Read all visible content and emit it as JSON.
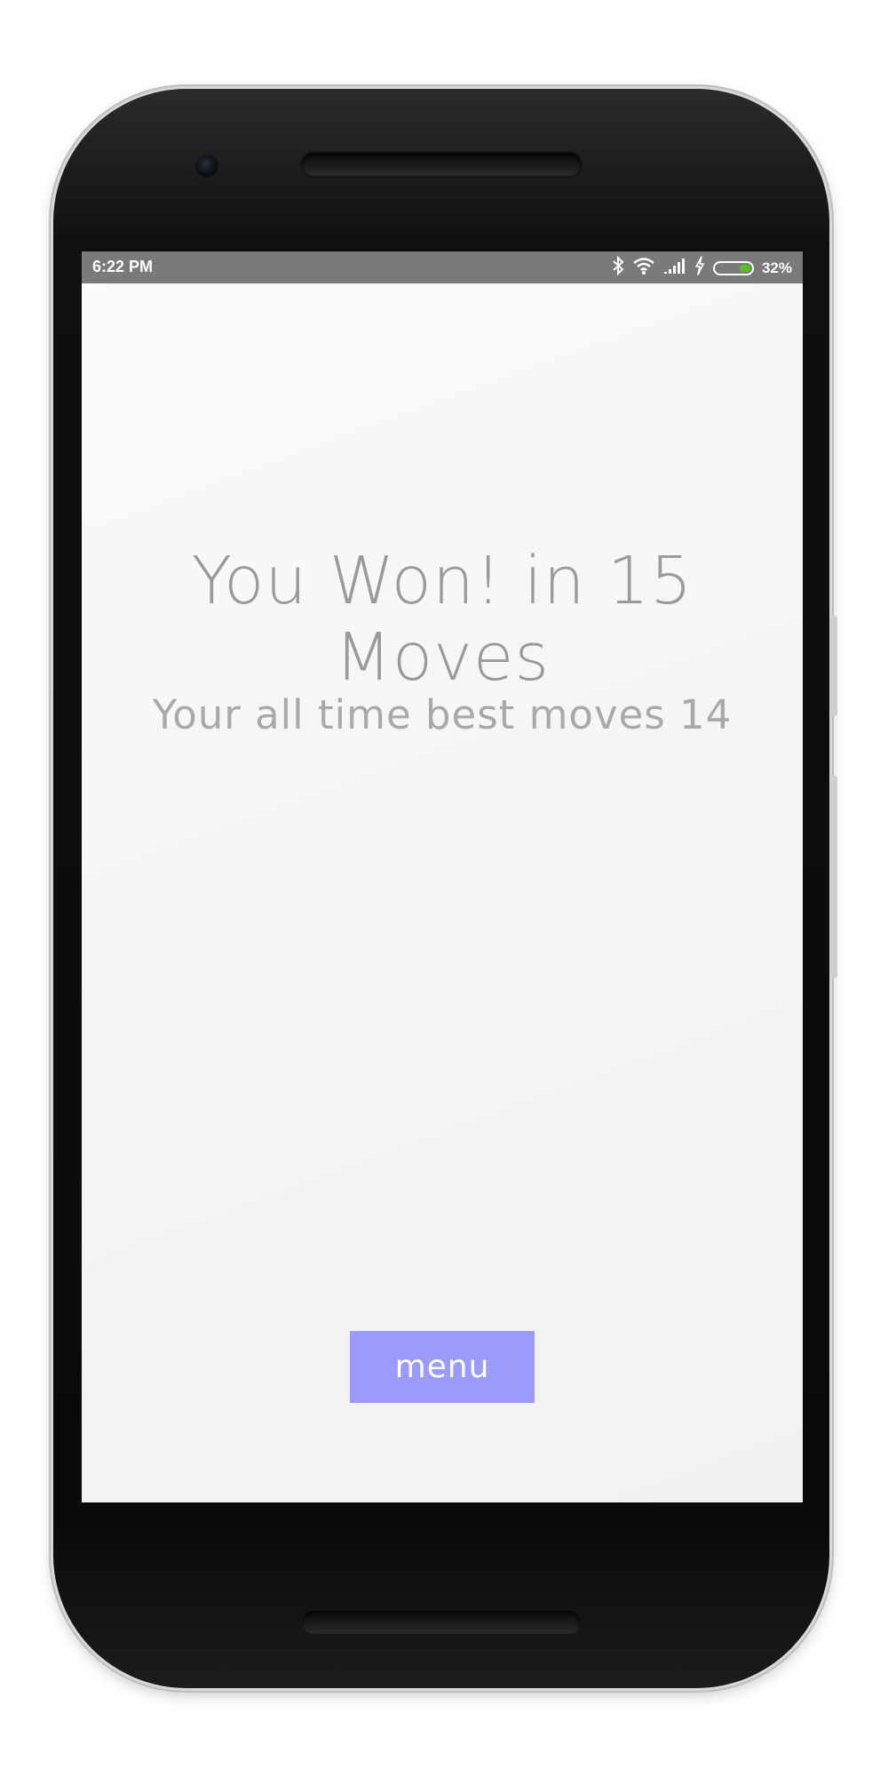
{
  "status_bar": {
    "time": "6:22 PM",
    "icons": [
      "bluetooth-icon",
      "wifi-icon",
      "signal-icon",
      "charging-icon",
      "battery-icon"
    ],
    "battery_level": 0.32,
    "battery_text": "32%",
    "battery_color": "#55c21b"
  },
  "game_over": {
    "title": "You Won! in 15 Moves",
    "best_moves": "Your all time best moves 14"
  },
  "menu_button": {
    "label": "menu",
    "color": "#9b9bfb"
  }
}
